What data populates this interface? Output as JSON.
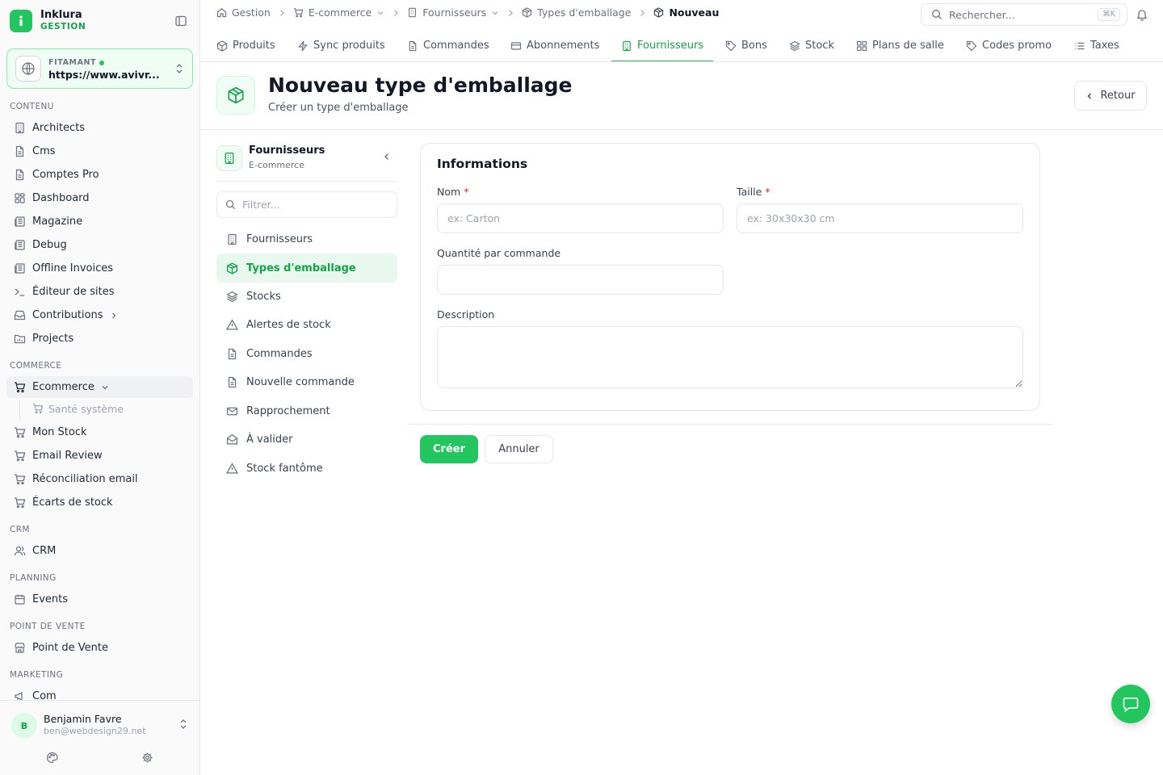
{
  "brand": {
    "name": "Inklura",
    "sub": "GESTION"
  },
  "site": {
    "label": "FITAMANT",
    "url": "https://www.avivr..."
  },
  "sidebar": {
    "sections": {
      "content": "CONTENU",
      "commerce": "COMMERCE",
      "crm": "CRM",
      "planning": "PLANNING",
      "pos": "POINT DE VENTE",
      "marketing": "MARKETING"
    },
    "content_items": [
      {
        "label": "Architects",
        "icon": "building-icon"
      },
      {
        "label": "Cms",
        "icon": "file-icon"
      },
      {
        "label": "Comptes Pro",
        "icon": "file-icon"
      },
      {
        "label": "Dashboard",
        "icon": "grid-icon"
      },
      {
        "label": "Magazine",
        "icon": "newspaper-icon"
      },
      {
        "label": "Debug",
        "icon": "newspaper-icon"
      },
      {
        "label": "Offline Invoices",
        "icon": "newspaper-icon"
      },
      {
        "label": "Éditeur de sites",
        "icon": "terminal-icon"
      },
      {
        "label": "Contributions",
        "icon": "inbox-icon"
      },
      {
        "label": "Projects",
        "icon": "folder-icon"
      }
    ],
    "commerce_items": [
      {
        "label": "Ecommerce",
        "icon": "cart-icon"
      },
      {
        "label": "Santé système",
        "icon": "cart-icon"
      },
      {
        "label": "Mon Stock",
        "icon": "cart-icon"
      },
      {
        "label": "Email Review",
        "icon": "cart-icon"
      },
      {
        "label": "Réconciliation email",
        "icon": "cart-icon"
      },
      {
        "label": "Écarts de stock",
        "icon": "cart-icon"
      }
    ],
    "crm_item": "CRM",
    "planning_item": "Events",
    "pos_item": "Point de Vente",
    "marketing_item": "Com"
  },
  "user": {
    "initial": "B",
    "name": "Benjamin Favre",
    "email": "ben@webdesign29.net"
  },
  "breadcrumb": [
    "Gestion",
    "E-commerce",
    "Fournisseurs",
    "Types d'emballage",
    "Nouveau"
  ],
  "search": {
    "placeholder": "Rechercher...",
    "shortcut": "⌘K"
  },
  "tabs": [
    "Produits",
    "Sync produits",
    "Commandes",
    "Abonnements",
    "Fournisseurs",
    "Bons",
    "Stock",
    "Plans de salle",
    "Codes promo",
    "Taxes"
  ],
  "active_tab": "Fournisseurs",
  "page": {
    "title": "Nouveau type d'emballage",
    "subtitle": "Créer un type d'emballage",
    "back": "Retour"
  },
  "subnav": {
    "title": "Fournisseurs",
    "subtitle": "E-commerce",
    "filter_placeholder": "Filtrer...",
    "items": [
      {
        "label": "Fournisseurs",
        "icon": "building-icon"
      },
      {
        "label": "Types d'emballage",
        "icon": "package-icon",
        "active": true
      },
      {
        "label": "Stocks",
        "icon": "layers-icon"
      },
      {
        "label": "Alertes de stock",
        "icon": "warning-icon"
      },
      {
        "label": "Commandes",
        "icon": "file-icon"
      },
      {
        "label": "Nouvelle commande",
        "icon": "file-icon"
      },
      {
        "label": "Rapprochement",
        "icon": "mail-icon"
      },
      {
        "label": "À valider",
        "icon": "mail-open-icon"
      },
      {
        "label": "Stock fantôme",
        "icon": "warning-icon"
      }
    ]
  },
  "form": {
    "section_title": "Informations",
    "name_label": "Nom",
    "name_placeholder": "ex: Carton",
    "size_label": "Taille",
    "size_placeholder": "ex: 30x30x30 cm",
    "qty_label": "Quantité par commande",
    "desc_label": "Description",
    "required_mark": "*",
    "submit": "Créer",
    "cancel": "Annuler"
  },
  "colors": {
    "accent": "#22c55e",
    "accent_dark": "#16a34a",
    "required": "#dc2626"
  }
}
